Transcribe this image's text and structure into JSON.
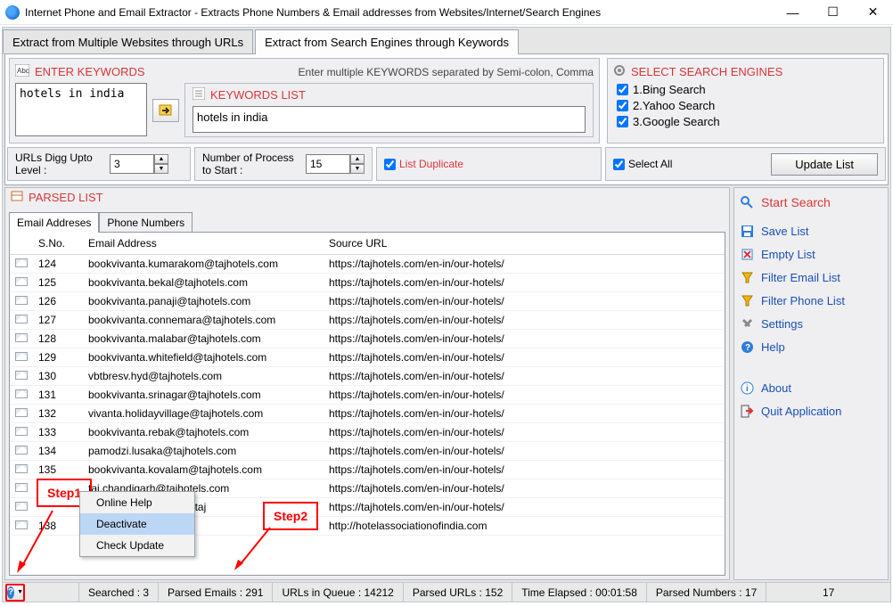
{
  "window": {
    "title": "Internet Phone and Email Extractor - Extracts Phone Numbers & Email addresses from Websites/Internet/Search Engines"
  },
  "tabs": {
    "urls": "Extract from Multiple Websites through URLs",
    "keywords": "Extract from Search Engines through Keywords"
  },
  "keywords_panel": {
    "title": "ENTER KEYWORDS",
    "hint": "Enter multiple KEYWORDS separated by Semi-colon, Comma",
    "input_value": "hotels in india",
    "list_title": "KEYWORDS LIST",
    "list_value": "hotels in india"
  },
  "engines_panel": {
    "title": "SELECT SEARCH ENGINES",
    "items": [
      {
        "label": "1.Bing Search",
        "checked": true
      },
      {
        "label": "2.Yahoo Search",
        "checked": true
      },
      {
        "label": "3.Google Search",
        "checked": true
      }
    ]
  },
  "options": {
    "digg_label": "URLs Digg Upto Level :",
    "digg_value": "3",
    "process_label": "Number of Process to Start :",
    "process_value": "15",
    "list_duplicate": "List Duplicate",
    "list_duplicate_checked": true,
    "select_all_label": "Select All",
    "select_all_checked": true,
    "update_btn": "Update List"
  },
  "parsed": {
    "title": "PARSED LIST",
    "tab_email": "Email Addreses",
    "tab_phone": "Phone Numbers",
    "col_sno": "S.No.",
    "col_email": "Email Address",
    "col_url": "Source URL",
    "rows": [
      {
        "sno": "124",
        "email": "bookvivanta.kumarakom@tajhotels.com",
        "url": "https://tajhotels.com/en-in/our-hotels/"
      },
      {
        "sno": "125",
        "email": "bookvivanta.bekal@tajhotels.com",
        "url": "https://tajhotels.com/en-in/our-hotels/"
      },
      {
        "sno": "126",
        "email": "bookvivanta.panaji@tajhotels.com",
        "url": "https://tajhotels.com/en-in/our-hotels/"
      },
      {
        "sno": "127",
        "email": "bookvivanta.connemara@tajhotels.com",
        "url": "https://tajhotels.com/en-in/our-hotels/"
      },
      {
        "sno": "128",
        "email": "bookvivanta.malabar@tajhotels.com",
        "url": "https://tajhotels.com/en-in/our-hotels/"
      },
      {
        "sno": "129",
        "email": "bookvivanta.whitefield@tajhotels.com",
        "url": "https://tajhotels.com/en-in/our-hotels/"
      },
      {
        "sno": "130",
        "email": "vbtbresv.hyd@tajhotels.com",
        "url": "https://tajhotels.com/en-in/our-hotels/"
      },
      {
        "sno": "131",
        "email": "bookvivanta.srinagar@tajhotels.com",
        "url": "https://tajhotels.com/en-in/our-hotels/"
      },
      {
        "sno": "132",
        "email": "vivanta.holidayvillage@tajhotels.com",
        "url": "https://tajhotels.com/en-in/our-hotels/"
      },
      {
        "sno": "133",
        "email": "bookvivanta.rebak@tajhotels.com",
        "url": "https://tajhotels.com/en-in/our-hotels/"
      },
      {
        "sno": "134",
        "email": "pamodzi.lusaka@tajhotels.com",
        "url": "https://tajhotels.com/en-in/our-hotels/"
      },
      {
        "sno": "135",
        "email": "bookvivanta.kovalam@tajhotels.com",
        "url": "https://tajhotels.com/en-in/our-hotels/"
      },
      {
        "sno": "",
        "email": "taj.chandigarh@tajhotels.com",
        "url": "https://tajhotels.com/en-in/our-hotels/"
      },
      {
        "sno": "",
        "email": "bookvivanta.bentota@taj",
        "url": "https://tajhotels.com/en-in/our-hotels/"
      },
      {
        "sno": "138",
        "email": "",
        "url": "http://hotelassociationofindia.com"
      }
    ]
  },
  "side": {
    "start": "Start Search",
    "save": "Save List",
    "empty": "Empty List",
    "filter_email": "Filter Email List",
    "filter_phone": "Filter Phone List",
    "settings": "Settings",
    "help": "Help",
    "about": "About",
    "quit": "Quit Application"
  },
  "context_menu": {
    "online_help": "Online Help",
    "deactivate": "Deactivate",
    "check_update": "Check Update"
  },
  "annotations": {
    "step1": "Step1",
    "step2": "Step2"
  },
  "status": {
    "searched": "Searched : 3",
    "parsed_emails": "Parsed Emails :  291",
    "urls_queue": "URLs in Queue :  14212",
    "parsed_urls": "Parsed URLs :  152",
    "time": "Time Elapsed :   00:01:58",
    "parsed_numbers": "Parsed Numbers :  17",
    "extra": "17"
  }
}
